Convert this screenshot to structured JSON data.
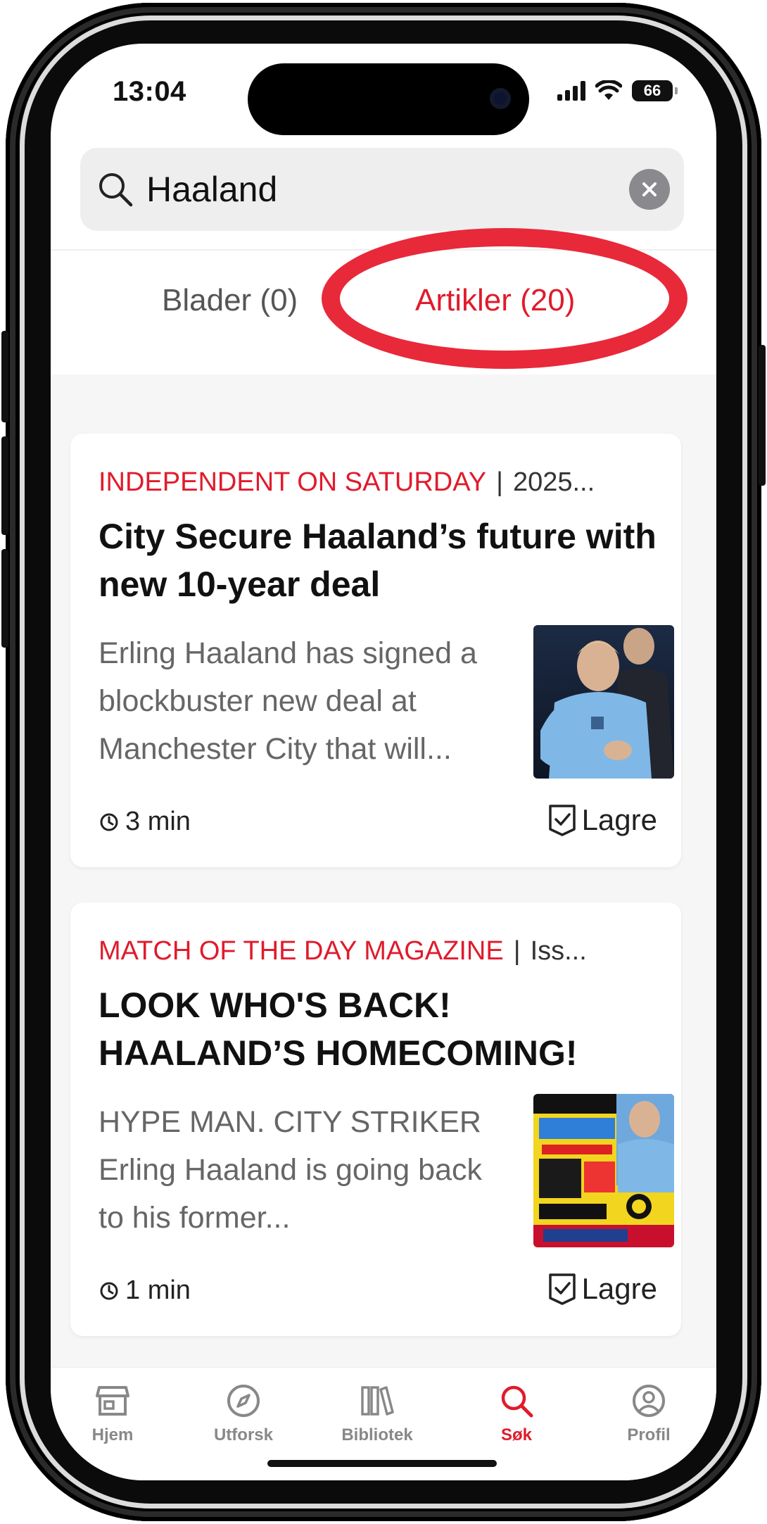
{
  "status_bar": {
    "time": "13:04",
    "battery": "66"
  },
  "search": {
    "query": "Haaland"
  },
  "tabs": [
    {
      "label": "Blader (0)",
      "active": false
    },
    {
      "label": "Artikler (20)",
      "active": true
    }
  ],
  "articles": [
    {
      "source": "INDEPENDENT ON SATURDAY",
      "date": "2025...",
      "title": "City Secure Haaland’s future with new 10-year deal",
      "excerpt": "Erling Haaland has signed a blockbuster new deal at Manchester City that will...",
      "read_time": "3 min",
      "save_label": "Lagre"
    },
    {
      "source": "MATCH OF THE DAY MAGAZINE",
      "date": "Iss...",
      "title": "LOOK WHO'S BACK! HAALAND’S HOMECOMING!",
      "excerpt": "HYPE MAN. CITY STRIKER Erling Haaland is going back to his former...",
      "read_time": "1 min",
      "save_label": "Lagre"
    }
  ],
  "tab_bar": [
    {
      "label": "Hjem",
      "icon": "store-icon",
      "active": false
    },
    {
      "label": "Utforsk",
      "icon": "compass-icon",
      "active": false
    },
    {
      "label": "Bibliotek",
      "icon": "library-icon",
      "active": false
    },
    {
      "label": "Søk",
      "icon": "search-icon",
      "active": true
    },
    {
      "label": "Profil",
      "icon": "profile-icon",
      "active": false
    }
  ],
  "colors": {
    "accent": "#e01b2c",
    "annotation": "#e8293a"
  }
}
